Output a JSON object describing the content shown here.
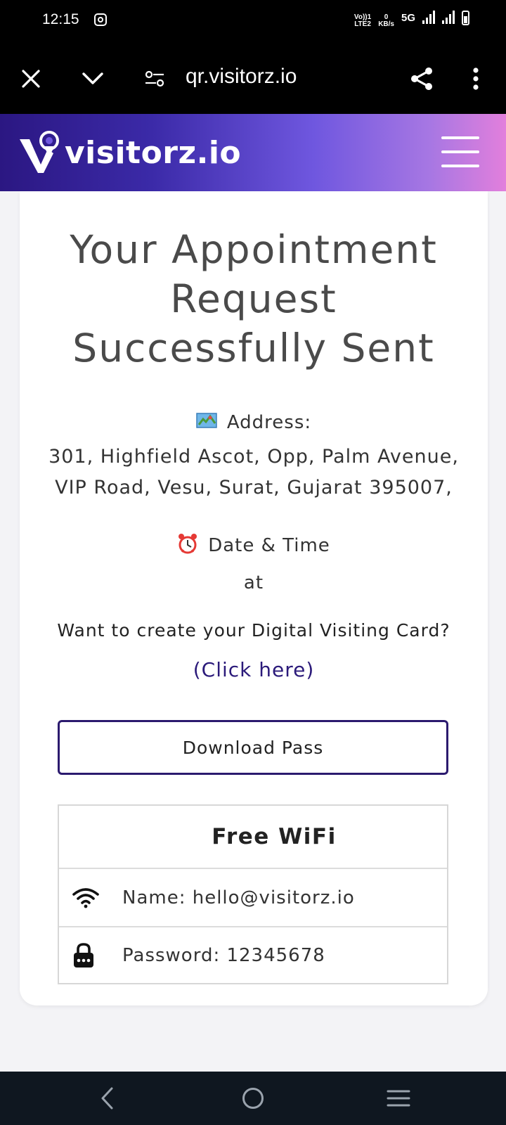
{
  "status_bar": {
    "time": "12:15",
    "volte": "Vo))1",
    "lte": "LTE2",
    "data_rate_value": "0",
    "data_rate_unit": "KB/s",
    "network": "5G",
    "icons": [
      "instagram-icon",
      "signal-icon",
      "battery-icon"
    ]
  },
  "browser": {
    "url": "qr.visitorz.io",
    "icons": [
      "close-icon",
      "chevron-down-icon",
      "site-settings-icon",
      "share-icon",
      "more-vert-icon"
    ]
  },
  "header": {
    "logo_text": "visitorz.io",
    "menu_icon": "hamburger-icon"
  },
  "main": {
    "title_lines": [
      "Your Appointment",
      "Request",
      "Successfully Sent"
    ],
    "address_label": "Address:",
    "address_lines": [
      "301, Highfield Ascot, Opp, Palm Avenue,",
      "VIP Road, Vesu, Surat, Gujarat 395007,"
    ],
    "datetime_label": "Date & Time",
    "at_text": "at",
    "card_prompt": "Want to create your Digital Visiting Card?",
    "click_link": "(Click here)",
    "download_button": "Download Pass"
  },
  "wifi": {
    "title": "Free WiFi",
    "name_row": "Name: hello@visitorz.io",
    "password_row": "Password: 12345678"
  },
  "colors": {
    "header_gradient_start": "#2b1782",
    "header_gradient_end": "#e27fdc",
    "link": "#2b1a7a",
    "button_border": "#2b1a6e"
  }
}
